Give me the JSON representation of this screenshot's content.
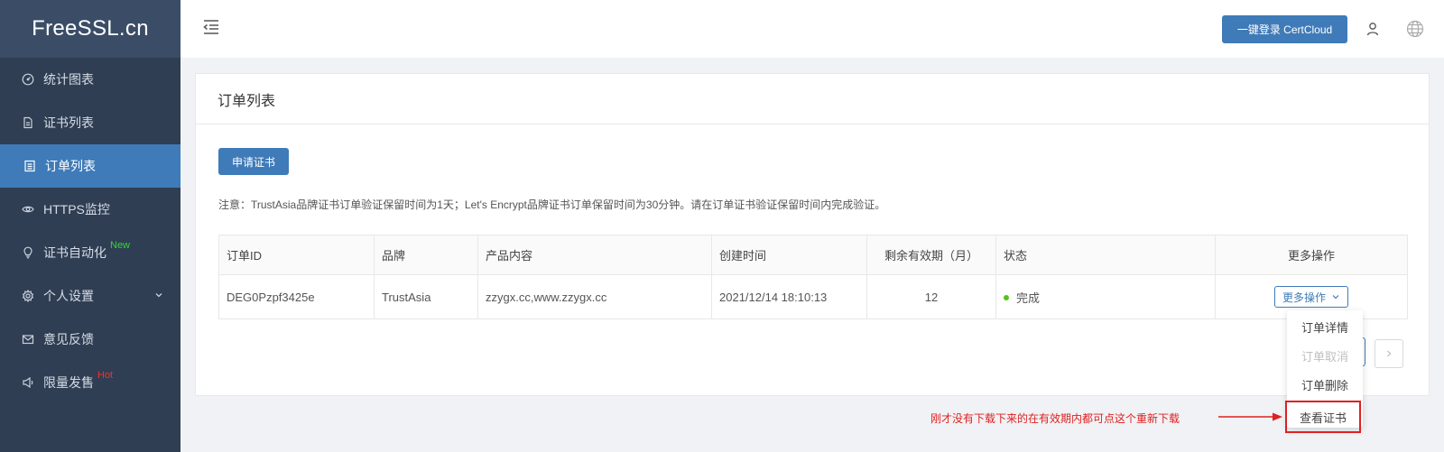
{
  "app": {
    "logo": "FreeSSL.cn"
  },
  "sidebar": {
    "items": [
      {
        "label": "统计图表",
        "icon": "dashboard-icon"
      },
      {
        "label": "证书列表",
        "icon": "file-icon"
      },
      {
        "label": "订单列表",
        "icon": "list-icon",
        "active": true
      },
      {
        "label": "HTTPS监控",
        "icon": "eye-icon"
      },
      {
        "label": "证书自动化",
        "icon": "bulb-icon",
        "badge": "New"
      },
      {
        "label": "个人设置",
        "icon": "gear-icon",
        "has_children": true
      },
      {
        "label": "意见反馈",
        "icon": "mail-icon"
      },
      {
        "label": "限量发售",
        "icon": "megaphone-icon",
        "badge": "Hot"
      }
    ]
  },
  "topbar": {
    "cert_button": "一键登录 CertCloud",
    "icons": [
      "menu-fold-icon",
      "user-icon",
      "globe-icon"
    ]
  },
  "card": {
    "title": "订单列表",
    "apply_button": "申请证书",
    "notice": "注意：TrustAsia品牌证书订单验证保留时间为1天；Let's Encrypt品牌证书订单保留时间为30分钟。请在订单证书验证保留时间内完成验证。"
  },
  "table": {
    "headers": [
      "订单ID",
      "品牌",
      "产品内容",
      "创建时间",
      "剩余有效期（月）",
      "状态",
      "更多操作"
    ],
    "rows": [
      {
        "order_id": "DEG0Pzpf3425e",
        "brand": "TrustAsia",
        "product": "zzygx.cc,www.zzygx.cc",
        "created": "2021/12/14 18:10:13",
        "remaining": "12",
        "status": "完成",
        "more": "更多操作"
      }
    ]
  },
  "dropdown": {
    "items": [
      "订单详情",
      "订单取消",
      "订单删除",
      "查看证书"
    ],
    "disabled": [
      "订单取消"
    ]
  },
  "annotation": {
    "text": "刚才没有下载下来的在有效期内都可点这个重新下载",
    "color": "#e02020"
  },
  "colors": {
    "primary": "#3f7bb8",
    "sidebar": "#2f3e53",
    "success": "#52c41a"
  }
}
